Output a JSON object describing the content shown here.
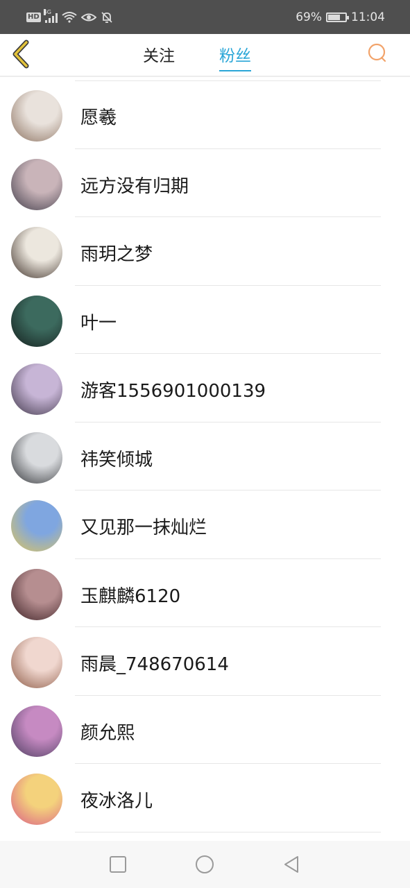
{
  "status_bar": {
    "hd": "HD",
    "network": "4G",
    "battery": "69%",
    "time": "11:04"
  },
  "nav": {
    "tab_follow": "关注",
    "tab_fans": "粉丝",
    "active_tab_color": "#2aa6d7",
    "back_icon_color": "#e2c23a",
    "search_icon_color": "#f2a36a"
  },
  "fans": [
    {
      "name": "愿羲",
      "avatar_colors": [
        "#e9e2dc",
        "#8a6f5d"
      ]
    },
    {
      "name": "远方没有归期",
      "avatar_colors": [
        "#c9b4b9",
        "#3e3a47"
      ]
    },
    {
      "name": "雨玥之梦",
      "avatar_colors": [
        "#ece7de",
        "#3b2d25"
      ]
    },
    {
      "name": "叶一",
      "avatar_colors": [
        "#3c6a5e",
        "#141d1c"
      ]
    },
    {
      "name": "游客1556901000139",
      "avatar_colors": [
        "#c7b5d6",
        "#3e3547"
      ]
    },
    {
      "name": "祎笑倾城",
      "avatar_colors": [
        "#d9dbde",
        "#303236"
      ]
    },
    {
      "name": "又见那一抹灿烂",
      "avatar_colors": [
        "#7fa6e0",
        "#e0c65a"
      ]
    },
    {
      "name": "玉麒麟6120",
      "avatar_colors": [
        "#b68e90",
        "#3b1f23"
      ]
    },
    {
      "name": "雨晨_748670614",
      "avatar_colors": [
        "#f0d7cf",
        "#8a5742"
      ]
    },
    {
      "name": "颜允熙",
      "avatar_colors": [
        "#c68ac2",
        "#4a3c5e"
      ]
    },
    {
      "name": "夜冰洛儿",
      "avatar_colors": [
        "#f4d27c",
        "#d95a86"
      ]
    }
  ]
}
